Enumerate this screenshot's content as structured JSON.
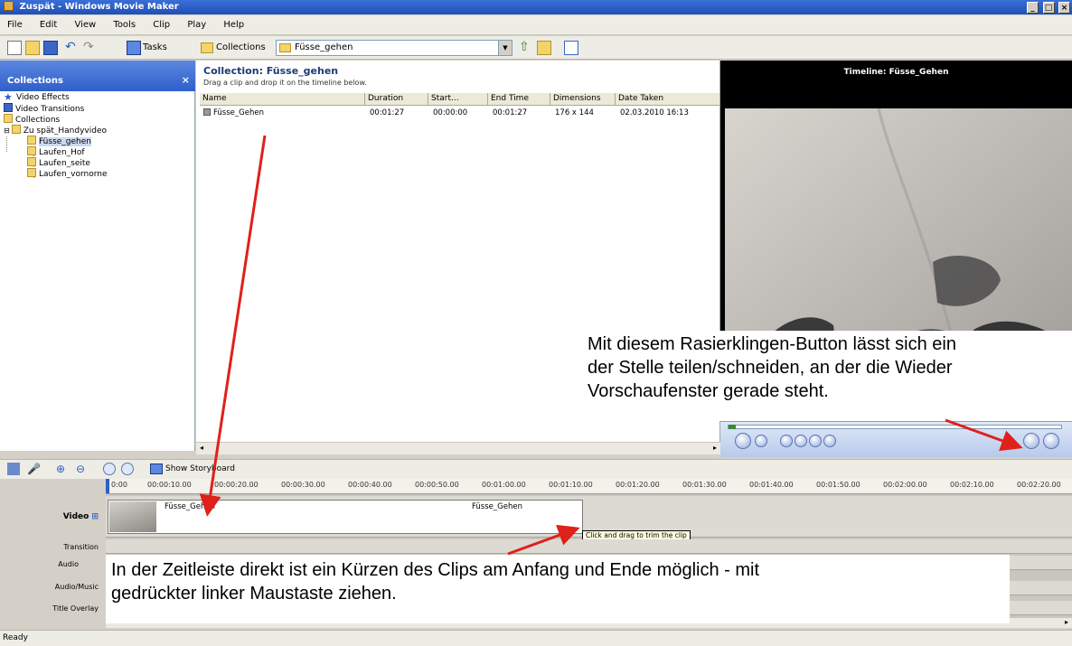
{
  "window": {
    "title": "Zuspät - Windows Movie Maker",
    "controls": [
      "_",
      "□",
      "×"
    ]
  },
  "menu": [
    "File",
    "Edit",
    "View",
    "Tools",
    "Clip",
    "Play",
    "Help"
  ],
  "toolbar": {
    "tasks_label": "Tasks",
    "collections_label": "Collections",
    "collection_combo_value": "Füsse_gehen"
  },
  "collections_pane": {
    "header": "Collections",
    "close": "×",
    "items": [
      {
        "label": "Video Effects",
        "icon": "video-effects-icon"
      },
      {
        "label": "Video Transitions",
        "icon": "video-transitions-icon"
      },
      {
        "label": "Collections",
        "icon": "folder-icon"
      },
      {
        "label": "Zu spät_Handyvideo",
        "icon": "folder-icon"
      },
      {
        "label": "Füsse_gehen",
        "icon": "folder-icon",
        "selected": true
      },
      {
        "label": "Laufen_Hof",
        "icon": "folder-icon"
      },
      {
        "label": "Laufen_seite",
        "icon": "folder-icon"
      },
      {
        "label": "Laufen_vornorne",
        "icon": "folder-icon"
      }
    ]
  },
  "content": {
    "title": "Collection: Füsse_gehen",
    "subtitle": "Drag a clip and drop it on the timeline below.",
    "columns": [
      "Name",
      "Duration",
      "Start...",
      "End Time",
      "Dimensions",
      "Date Taken"
    ],
    "rows": [
      {
        "name": "Füsse_Gehen",
        "duration": "00:01:27",
        "start": "00:00:00",
        "end": "00:01:27",
        "dimensions": "176 x 144",
        "date": "02.03.2010 16:13"
      }
    ]
  },
  "preview": {
    "title": "Timeline: Füsse_Gehen"
  },
  "annotation_top": {
    "line1": "Mit diesem Rasierklingen-Button lässt sich ein",
    "line2": "der Stelle teilen/schneiden, an der die Wieder",
    "line3": "Vorschaufenster gerade steht."
  },
  "timeline": {
    "storyboard_label": "Show Storyboard",
    "ticks": [
      "0:00",
      "00:00:10.00",
      "00:00:20.00",
      "00:00:30.00",
      "00:00:40.00",
      "00:00:50.00",
      "00:01:00.00",
      "00:01:10.00",
      "00:01:20.00",
      "00:01:30.00",
      "00:01:40.00",
      "00:01:50.00",
      "00:02:00.00",
      "00:02:10.00",
      "00:02:20.00"
    ],
    "tracks": {
      "video": "Video",
      "transition": "Transition",
      "audio": "Audio",
      "audio_music": "Audio/Music",
      "title_overlay": "Title Overlay"
    },
    "clip_name_1": "Füsse_Gehen",
    "clip_name_2": "Füsse_Gehen",
    "tooltip": "Click and drag to trim the clip"
  },
  "annotation_bottom": {
    "line1": "In der Zeitleiste direkt ist ein Kürzen des Clips am Anfang und Ende möglich - mit",
    "line2": "gedrückter linker Maustaste ziehen."
  },
  "status": "Ready",
  "colors": {
    "title_bar": "#2f5fc9",
    "arrow": "#e0201a",
    "panel_bg": "#d4d0c8"
  }
}
